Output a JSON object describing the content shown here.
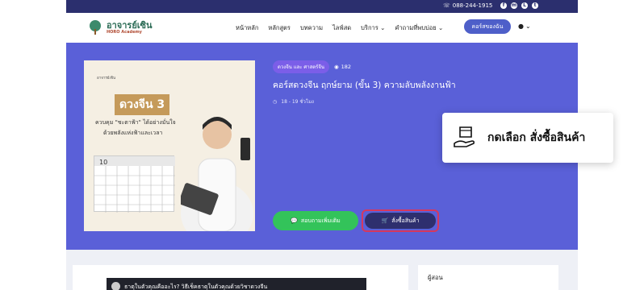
{
  "topbar": {
    "phone": "088-244-1915",
    "socials": [
      "f",
      "m",
      "L",
      "t"
    ]
  },
  "header": {
    "logo_name": "อาจารย์เซิน",
    "logo_sub": "HORO Academy",
    "nav": [
      "หน้าหลัก",
      "หลักสูตร",
      "บทความ",
      "ไลฟ์สด",
      "บริการ ⌄",
      "คำถามที่พบบ่อย ⌄"
    ],
    "cta": "คอร์สของฉัน",
    "user_icon": "user-icon"
  },
  "course": {
    "category": "ดวงจีน และ ศาสตร์จีน",
    "views": "182",
    "title": "คอร์สดวงจีน ฤกษ์ยาม (ขั้น 3) ความลับพลังงานฟ้า",
    "hours": "18 - 19 ชั่วโมง",
    "cover_headline": "ดวงจีน 3",
    "cover_line1": "ควบคุม \"ชะตาฟ้า\" ได้อย่างมั่นใจ",
    "cover_line2": "ด้วยพลังแห่งฟ้าและเวลา",
    "cover_logo": "อาจารย์เซิน",
    "calendar_label": "10"
  },
  "buttons": {
    "line": "สอบถามเพิ่มเติม",
    "order": "สั่งซื้อสินค้า"
  },
  "video": {
    "title": "ธาตุในตัวคุณคืออะไร? วิธีเช็คธาตุในตัวคุณด้วยวิชาดวงจีน"
  },
  "sidebar": {
    "label": "ผู้สอน"
  },
  "popup": {
    "text": "กดเลือก สั่งซื้อสินค้า"
  },
  "colors": {
    "hero": "#5a60d8",
    "topbar": "#2b2f6e",
    "order_button": "#2e2f6e",
    "line_button": "#33c35a",
    "highlight": "#d6385d"
  }
}
